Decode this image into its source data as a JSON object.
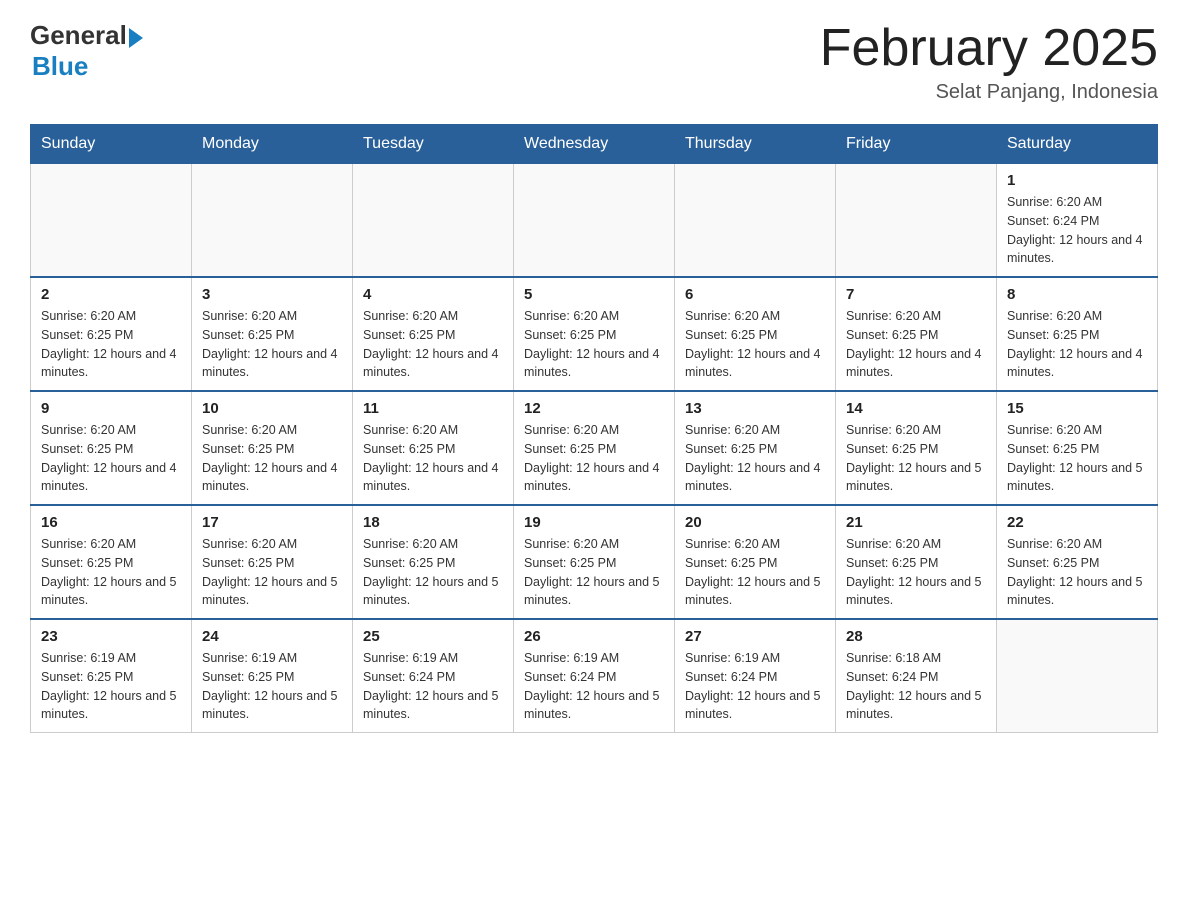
{
  "logo": {
    "general": "General",
    "blue": "Blue"
  },
  "title": "February 2025",
  "location": "Selat Panjang, Indonesia",
  "days_of_week": [
    "Sunday",
    "Monday",
    "Tuesday",
    "Wednesday",
    "Thursday",
    "Friday",
    "Saturday"
  ],
  "weeks": [
    [
      {
        "day": "",
        "info": ""
      },
      {
        "day": "",
        "info": ""
      },
      {
        "day": "",
        "info": ""
      },
      {
        "day": "",
        "info": ""
      },
      {
        "day": "",
        "info": ""
      },
      {
        "day": "",
        "info": ""
      },
      {
        "day": "1",
        "info": "Sunrise: 6:20 AM\nSunset: 6:24 PM\nDaylight: 12 hours and 4 minutes."
      }
    ],
    [
      {
        "day": "2",
        "info": "Sunrise: 6:20 AM\nSunset: 6:25 PM\nDaylight: 12 hours and 4 minutes."
      },
      {
        "day": "3",
        "info": "Sunrise: 6:20 AM\nSunset: 6:25 PM\nDaylight: 12 hours and 4 minutes."
      },
      {
        "day": "4",
        "info": "Sunrise: 6:20 AM\nSunset: 6:25 PM\nDaylight: 12 hours and 4 minutes."
      },
      {
        "day": "5",
        "info": "Sunrise: 6:20 AM\nSunset: 6:25 PM\nDaylight: 12 hours and 4 minutes."
      },
      {
        "day": "6",
        "info": "Sunrise: 6:20 AM\nSunset: 6:25 PM\nDaylight: 12 hours and 4 minutes."
      },
      {
        "day": "7",
        "info": "Sunrise: 6:20 AM\nSunset: 6:25 PM\nDaylight: 12 hours and 4 minutes."
      },
      {
        "day": "8",
        "info": "Sunrise: 6:20 AM\nSunset: 6:25 PM\nDaylight: 12 hours and 4 minutes."
      }
    ],
    [
      {
        "day": "9",
        "info": "Sunrise: 6:20 AM\nSunset: 6:25 PM\nDaylight: 12 hours and 4 minutes."
      },
      {
        "day": "10",
        "info": "Sunrise: 6:20 AM\nSunset: 6:25 PM\nDaylight: 12 hours and 4 minutes."
      },
      {
        "day": "11",
        "info": "Sunrise: 6:20 AM\nSunset: 6:25 PM\nDaylight: 12 hours and 4 minutes."
      },
      {
        "day": "12",
        "info": "Sunrise: 6:20 AM\nSunset: 6:25 PM\nDaylight: 12 hours and 4 minutes."
      },
      {
        "day": "13",
        "info": "Sunrise: 6:20 AM\nSunset: 6:25 PM\nDaylight: 12 hours and 4 minutes."
      },
      {
        "day": "14",
        "info": "Sunrise: 6:20 AM\nSunset: 6:25 PM\nDaylight: 12 hours and 5 minutes."
      },
      {
        "day": "15",
        "info": "Sunrise: 6:20 AM\nSunset: 6:25 PM\nDaylight: 12 hours and 5 minutes."
      }
    ],
    [
      {
        "day": "16",
        "info": "Sunrise: 6:20 AM\nSunset: 6:25 PM\nDaylight: 12 hours and 5 minutes."
      },
      {
        "day": "17",
        "info": "Sunrise: 6:20 AM\nSunset: 6:25 PM\nDaylight: 12 hours and 5 minutes."
      },
      {
        "day": "18",
        "info": "Sunrise: 6:20 AM\nSunset: 6:25 PM\nDaylight: 12 hours and 5 minutes."
      },
      {
        "day": "19",
        "info": "Sunrise: 6:20 AM\nSunset: 6:25 PM\nDaylight: 12 hours and 5 minutes."
      },
      {
        "day": "20",
        "info": "Sunrise: 6:20 AM\nSunset: 6:25 PM\nDaylight: 12 hours and 5 minutes."
      },
      {
        "day": "21",
        "info": "Sunrise: 6:20 AM\nSunset: 6:25 PM\nDaylight: 12 hours and 5 minutes."
      },
      {
        "day": "22",
        "info": "Sunrise: 6:20 AM\nSunset: 6:25 PM\nDaylight: 12 hours and 5 minutes."
      }
    ],
    [
      {
        "day": "23",
        "info": "Sunrise: 6:19 AM\nSunset: 6:25 PM\nDaylight: 12 hours and 5 minutes."
      },
      {
        "day": "24",
        "info": "Sunrise: 6:19 AM\nSunset: 6:25 PM\nDaylight: 12 hours and 5 minutes."
      },
      {
        "day": "25",
        "info": "Sunrise: 6:19 AM\nSunset: 6:24 PM\nDaylight: 12 hours and 5 minutes."
      },
      {
        "day": "26",
        "info": "Sunrise: 6:19 AM\nSunset: 6:24 PM\nDaylight: 12 hours and 5 minutes."
      },
      {
        "day": "27",
        "info": "Sunrise: 6:19 AM\nSunset: 6:24 PM\nDaylight: 12 hours and 5 minutes."
      },
      {
        "day": "28",
        "info": "Sunrise: 6:18 AM\nSunset: 6:24 PM\nDaylight: 12 hours and 5 minutes."
      },
      {
        "day": "",
        "info": ""
      }
    ]
  ]
}
